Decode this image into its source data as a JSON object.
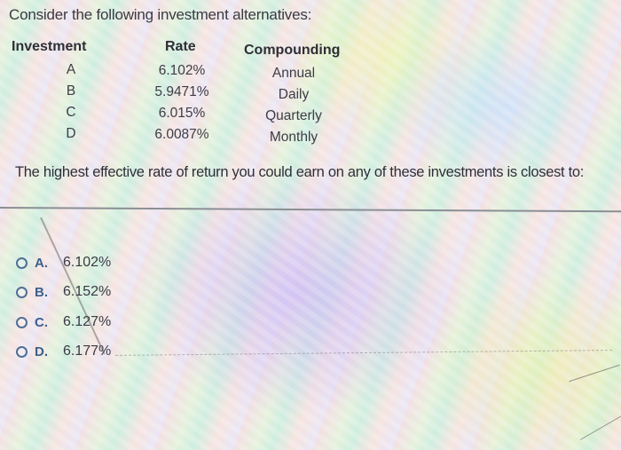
{
  "intro": "Consider the following investment alternatives:",
  "table": {
    "headers": {
      "investment": "Investment",
      "rate": "Rate",
      "compounding": "Compounding"
    },
    "rows": [
      {
        "investment": "A",
        "rate": "6.102%",
        "compounding": "Annual"
      },
      {
        "investment": "B",
        "rate": "5.9471%",
        "compounding": "Daily"
      },
      {
        "investment": "C",
        "rate": "6.015%",
        "compounding": "Quarterly"
      },
      {
        "investment": "D",
        "rate": "6.0087%",
        "compounding": "Monthly"
      }
    ]
  },
  "question": "The highest effective rate of return you could earn on any of these investments is closest to:",
  "options": [
    {
      "letter": "A.",
      "text": "6.102%",
      "selected": false
    },
    {
      "letter": "B.",
      "text": "6.152%",
      "selected": false
    },
    {
      "letter": "C.",
      "text": "6.127%",
      "selected": false
    },
    {
      "letter": "D.",
      "text": "6.177%",
      "selected": false
    }
  ],
  "colors": {
    "radio_border": "#4f6f95",
    "option_letter": "#3d5f8c"
  }
}
